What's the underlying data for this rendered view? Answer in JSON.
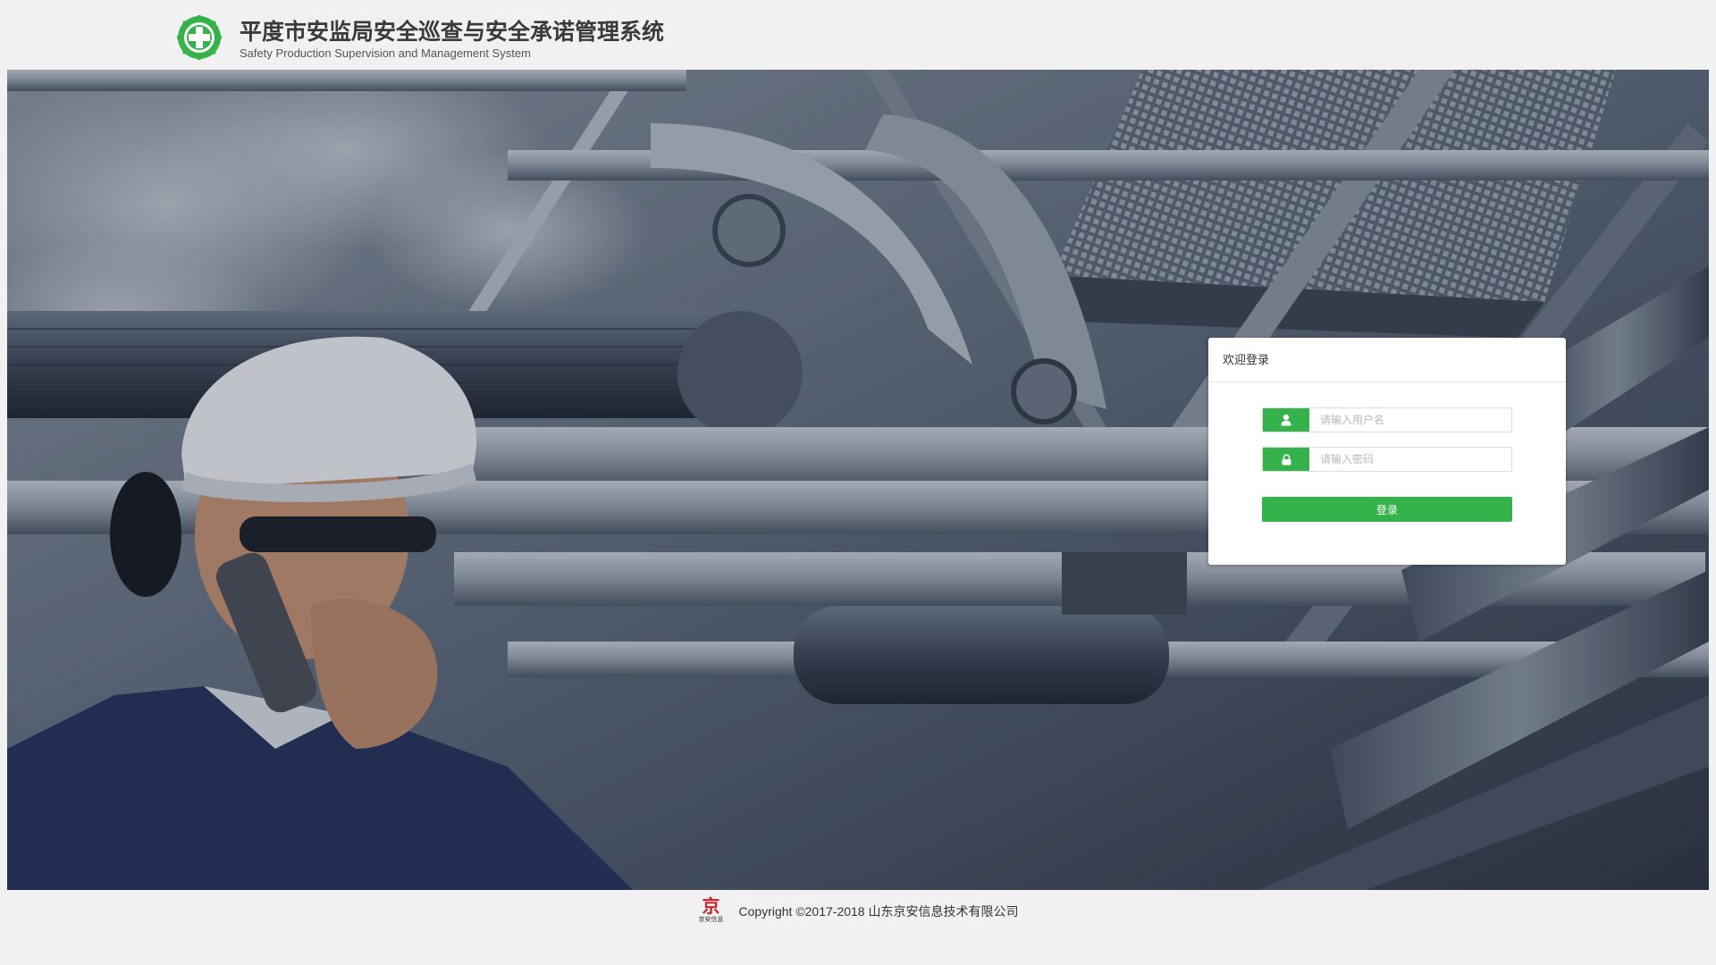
{
  "header": {
    "title": "平度市安监局安全巡查与安全承诺管理系统",
    "subtitle": "Safety Production Supervision and Management System",
    "logo_icon": "safety-cross-icon",
    "accent": "#36b24a"
  },
  "login": {
    "heading": "欢迎登录",
    "username_placeholder": "请输入用户名",
    "password_placeholder": "请输入密码",
    "username_icon": "user-icon",
    "password_icon": "lock-icon",
    "submit_label": "登录",
    "button_color": "#36b24a"
  },
  "footer": {
    "brand_glyph": "京",
    "brand_sub": "京安信息",
    "copyright": "Copyright ©2017-2018 山东京安信息技术有限公司",
    "brand_color": "#c8232c"
  }
}
